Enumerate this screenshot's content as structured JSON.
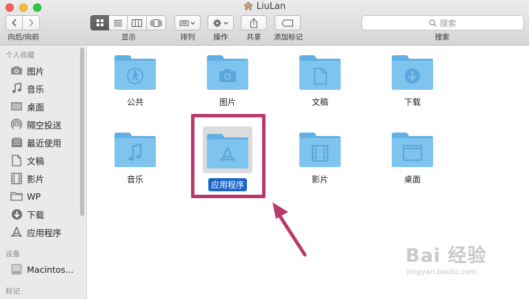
{
  "window": {
    "title": "LiuLan"
  },
  "toolbar": {
    "back_forward_label": "向后/向前",
    "view_label": "显示",
    "arrange_label": "排列",
    "action_label": "操作",
    "share_label": "共享",
    "tags_label": "添加标记",
    "search_label": "搜索",
    "search_placeholder": "搜索",
    "active_view": "icon-view"
  },
  "sidebar": {
    "favorites_header": "个人收藏",
    "items": [
      {
        "label": "图片",
        "icon": "camera-icon"
      },
      {
        "label": "音乐",
        "icon": "music-note-icon"
      },
      {
        "label": "桌面",
        "icon": "desktop-icon"
      },
      {
        "label": "隔空投送",
        "icon": "airdrop-icon"
      },
      {
        "label": "最近使用",
        "icon": "recents-icon"
      },
      {
        "label": "文稿",
        "icon": "document-icon"
      },
      {
        "label": "影片",
        "icon": "film-icon"
      },
      {
        "label": "WP",
        "icon": "folder-icon"
      },
      {
        "label": "下载",
        "icon": "download-icon"
      },
      {
        "label": "应用程序",
        "icon": "applications-icon"
      }
    ],
    "devices_header": "设备",
    "devices": [
      {
        "label": "Macintos...",
        "icon": "hard-drive-icon"
      }
    ],
    "tags_header": "标记"
  },
  "content": {
    "folders": [
      {
        "label": "公共",
        "icon": "public-folder-icon"
      },
      {
        "label": "图片",
        "icon": "pictures-folder-icon"
      },
      {
        "label": "文稿",
        "icon": "documents-folder-icon"
      },
      {
        "label": "下载",
        "icon": "downloads-folder-icon"
      },
      {
        "label": "音乐",
        "icon": "music-folder-icon"
      },
      {
        "label": "应用程序",
        "icon": "applications-folder-icon",
        "selected": true
      },
      {
        "label": "影片",
        "icon": "movies-folder-icon"
      },
      {
        "label": "桌面",
        "icon": "desktop-folder-icon"
      }
    ]
  },
  "colors": {
    "folder": "#7fc4ee",
    "folder_tab": "#5fb0e4",
    "selection": "#1a64c8",
    "annotation": "#b83a6a"
  },
  "watermark": {
    "brand": "Bai 经验",
    "url": "jingyan.baidu.com"
  }
}
